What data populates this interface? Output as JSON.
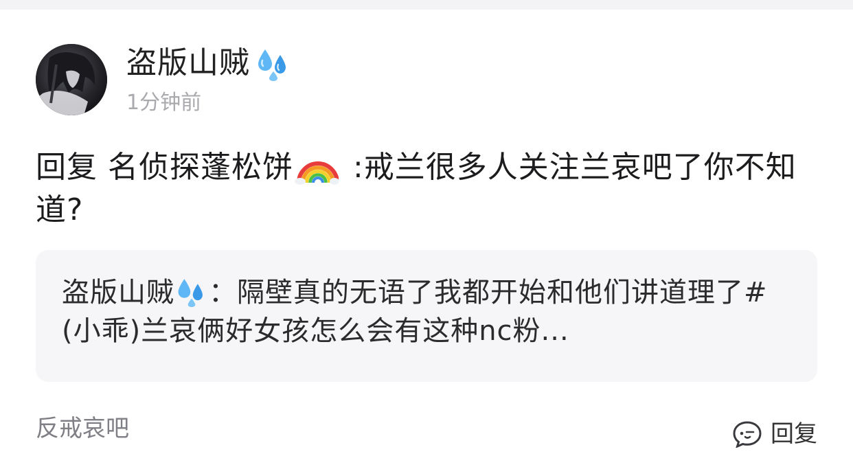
{
  "post": {
    "username": "盗版山贼",
    "timestamp": "1分钟前",
    "reply_prefix": "回复 名侦探蓬松饼",
    "reply_text": " :戒兰很多人关注兰哀吧了你不知道?"
  },
  "quote": {
    "author": "盗版山贼",
    "separator": "：",
    "text": "隔壁真的无语了我都开始和他们讲道理了#(小乖)兰哀俩好女孩怎么会有这种nc粉..."
  },
  "footer": {
    "tag": "反戒哀吧",
    "reply_label": "回复"
  },
  "icons": {
    "username_emoji": "sweat-droplets-icon",
    "reply_emoji": "rainbow-icon",
    "reply_button": "comment-bubble-icon"
  },
  "colors": {
    "accent": "#3b9bf3",
    "muted": "#a9a9ae",
    "quote_bg": "#f6f6f8"
  }
}
